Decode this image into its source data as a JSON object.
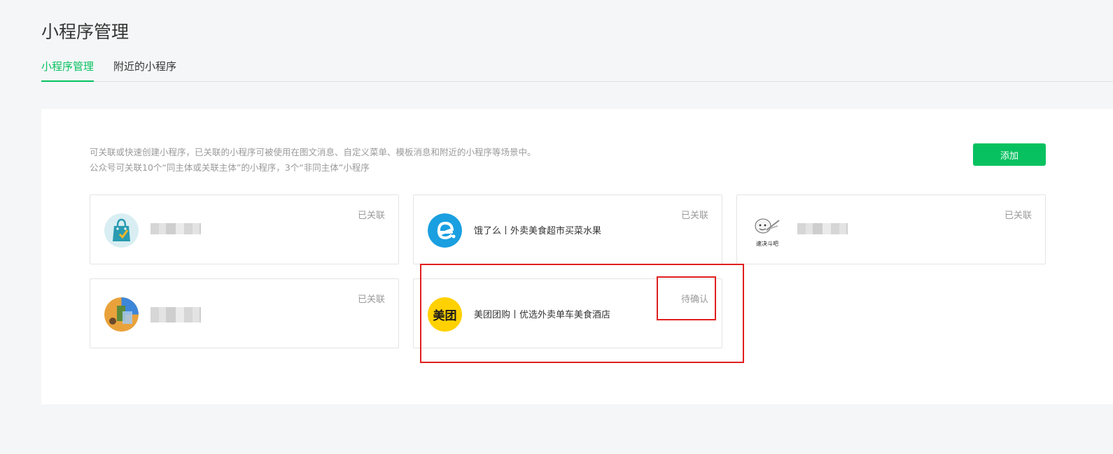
{
  "page": {
    "title": "小程序管理"
  },
  "tabs": [
    {
      "label": "小程序管理",
      "active": true
    },
    {
      "label": "附近的小程序",
      "active": false
    }
  ],
  "panel": {
    "desc_line1": "可关联或快速创建小程序，已关联的小程序可被使用在图文消息、自定义菜单、模板消息和附近的小程序等场景中。",
    "desc_line2": "公众号可关联10个“同主体或关联主体”的小程序，3个“非同主体”小程序",
    "add_label": "添加"
  },
  "cards": [
    {
      "name": "",
      "status": "已关联",
      "logo": "shopping-bag-icon"
    },
    {
      "name": "饿了么丨外卖美食超市买菜水果",
      "status": "已关联",
      "logo": "eleme-logo"
    },
    {
      "name": "",
      "status": "已关联",
      "logo": "cartoon-avatar-icon",
      "logo_caption": "速决斗吧"
    },
    {
      "name": "",
      "status": "已关联",
      "logo": "colorful-avatar-icon"
    },
    {
      "name": "美团团购丨优选外卖单车美食酒店",
      "status": "待确认",
      "logo": "meituan-logo",
      "logo_text": "美团"
    }
  ],
  "colors": {
    "accent": "#07c160",
    "annotation": "#e01f1f",
    "eleme": "#1a9fe0",
    "meituan": "#ffd100"
  }
}
